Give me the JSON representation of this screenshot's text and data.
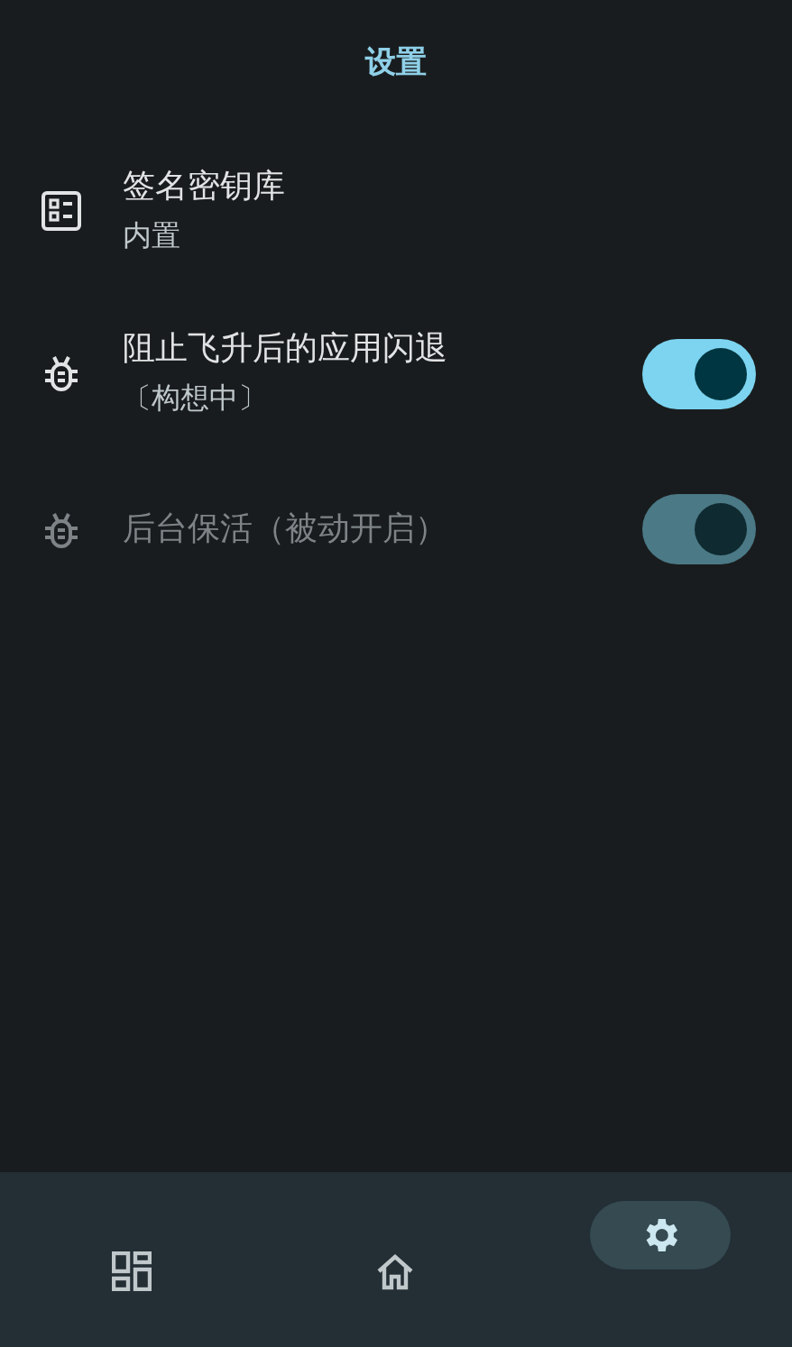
{
  "title": "设置",
  "settings": [
    {
      "kind": "link",
      "title": "签名密钥库",
      "subtitle": "内置",
      "disabled": false
    },
    {
      "kind": "switch",
      "title": "阻止飞升后的应用闪退",
      "subtitle": "〔构想中〕",
      "on": true,
      "disabled": false
    },
    {
      "kind": "switch",
      "title": "后台保活（被动开启）",
      "on": true,
      "disabled": true
    }
  ],
  "nav": [
    {
      "kind": "dashboard",
      "selected": false
    },
    {
      "kind": "home",
      "selected": false
    },
    {
      "kind": "settings",
      "selected": true
    }
  ]
}
